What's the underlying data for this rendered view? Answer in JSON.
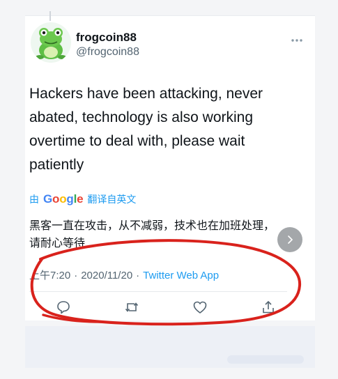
{
  "tweet": {
    "display_name": "frogcoin88",
    "handle": "@frogcoin88",
    "text": "Hackers have been attacking, never abated, technology is also working overtime to deal with, please wait patiently",
    "translation": {
      "by_label": "由",
      "provider": "Google",
      "action_label": "翻译自英文",
      "text": "黑客一直在攻击，从不减弱，技术也在加班处理，请耐心等待"
    },
    "meta": {
      "time": "上午7:20",
      "separator": "·",
      "date": "2020/11/20",
      "source": "Twitter Web App"
    }
  },
  "icons": {
    "avatar": "frog-avatar",
    "more": "more-horizontal-icon",
    "next": "chevron-right-icon",
    "reply": "reply-icon",
    "retweet": "retweet-icon",
    "like": "like-heart-icon",
    "share": "share-icon"
  },
  "colors": {
    "link_blue": "#1d9bf0",
    "secondary_text": "#536471",
    "annotation_red": "#d9221c",
    "google_blue": "#4285f4",
    "google_red": "#ea4335",
    "google_yellow": "#fbbc05",
    "google_green": "#34a853"
  }
}
